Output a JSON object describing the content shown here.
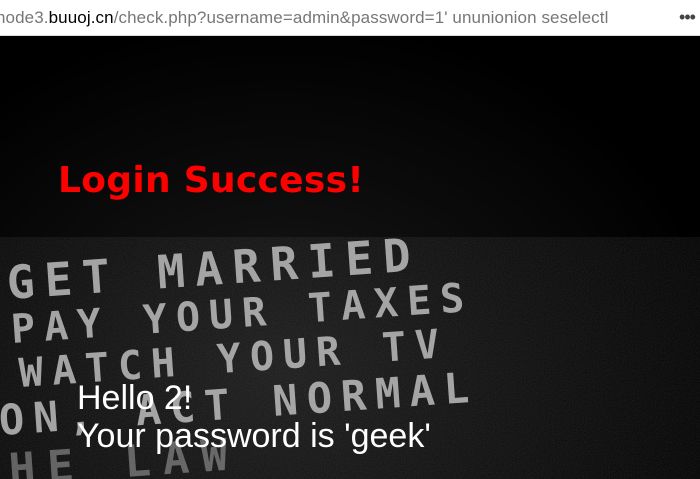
{
  "browser": {
    "url_prefix": "node3.",
    "url_domain": "buuoj.cn",
    "url_path": "/check.php?username=admin&password=1' ununionion seselectl",
    "more_icon": "ellipsis-icon"
  },
  "page": {
    "title": "Login Success!",
    "hello_line": "Hello 2!",
    "password_line": "Your password is 'geek'",
    "background_lines": [
      "GET MARRIED",
      "PAY YOUR TAXES",
      "WATCH YOUR TV",
      "ON, ACT NORMAL",
      "HE LAW"
    ],
    "colors": {
      "title": "#ff0000",
      "text": "#ffffff",
      "background": "#000000"
    }
  }
}
